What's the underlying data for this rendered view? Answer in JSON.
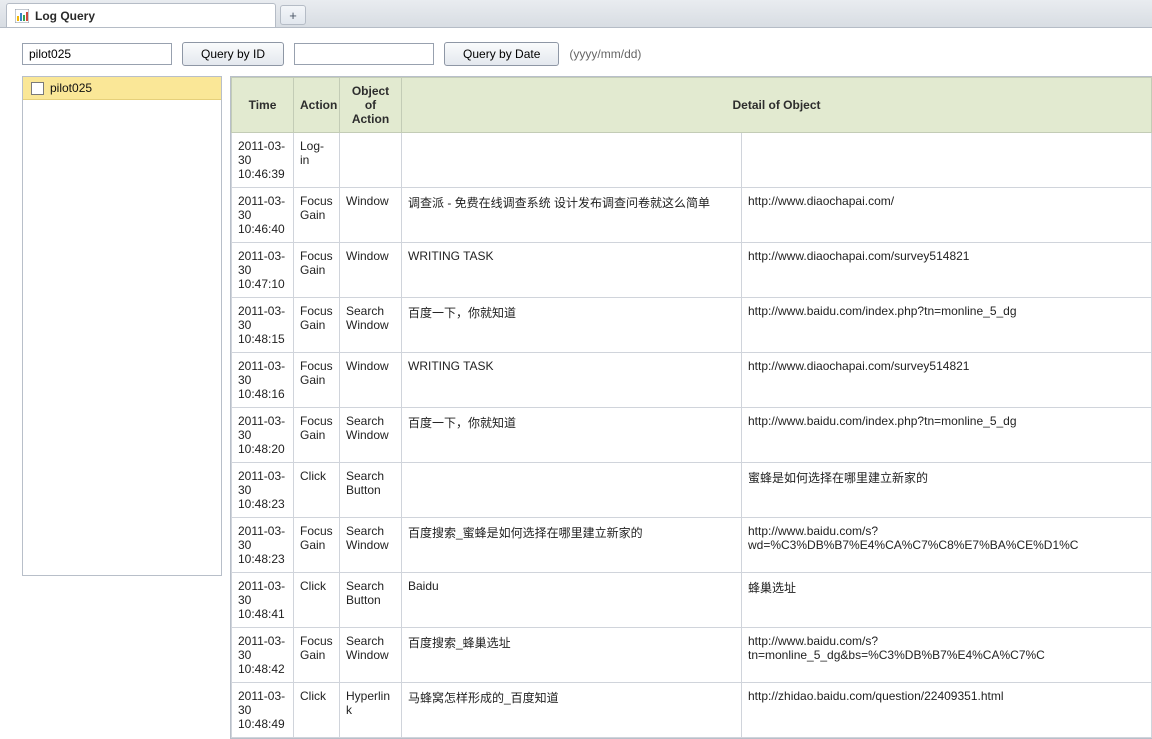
{
  "tab": {
    "title": "Log Query"
  },
  "query": {
    "id_value": "pilot025",
    "query_by_id_label": "Query by ID",
    "date_value": "",
    "query_by_date_label": "Query by Date",
    "date_hint": "(yyyy/mm/dd)"
  },
  "sidebar": {
    "items": [
      {
        "label": "pilot025"
      }
    ]
  },
  "table": {
    "columns": {
      "time": "Time",
      "action": "Action",
      "object_of_action": "Object of Action",
      "detail_of_object": "Detail of Object"
    },
    "rows": [
      {
        "time": "2011-03-30 10:46:39",
        "action": "Log-in",
        "object": "",
        "detail": "",
        "extra": "",
        "extra_link": false
      },
      {
        "time": "2011-03-30 10:46:40",
        "action": "Focus Gain",
        "object": "Window",
        "detail": "调查派 - 免费在线调查系统 设计发布调查问卷就这么简单",
        "extra": "http://www.diaochapai.com/",
        "extra_link": true
      },
      {
        "time": "2011-03-30 10:47:10",
        "action": "Focus Gain",
        "object": "Window",
        "detail": "WRITING TASK",
        "extra": "http://www.diaochapai.com/survey514821",
        "extra_link": true
      },
      {
        "time": "2011-03-30 10:48:15",
        "action": "Focus Gain",
        "object": "Search Window",
        "detail": "百度一下，你就知道",
        "extra": "http://www.baidu.com/index.php?tn=monline_5_dg",
        "extra_link": true
      },
      {
        "time": "2011-03-30 10:48:16",
        "action": "Focus Gain",
        "object": "Window",
        "detail": "WRITING TASK",
        "extra": "http://www.diaochapai.com/survey514821",
        "extra_link": true
      },
      {
        "time": "2011-03-30 10:48:20",
        "action": "Focus Gain",
        "object": "Search Window",
        "detail": "百度一下，你就知道",
        "extra": "http://www.baidu.com/index.php?tn=monline_5_dg",
        "extra_link": true
      },
      {
        "time": "2011-03-30 10:48:23",
        "action": "Click",
        "object": "Search Button",
        "detail": "",
        "extra": "蜜蜂是如何选择在哪里建立新家的",
        "extra_link": false
      },
      {
        "time": "2011-03-30 10:48:23",
        "action": "Focus Gain",
        "object": "Search Window",
        "detail": "百度搜索_蜜蜂是如何选择在哪里建立新家的",
        "extra": "http://www.baidu.com/s?wd=%C3%DB%B7%E4%CA%C7%C8%E7%BA%CE%D1%C",
        "extra_link": true
      },
      {
        "time": "2011-03-30 10:48:41",
        "action": "Click",
        "object": "Search Button",
        "detail": "Baidu",
        "extra": "蜂巢选址",
        "extra_link": false
      },
      {
        "time": "2011-03-30 10:48:42",
        "action": "Focus Gain",
        "object": "Search Window",
        "detail": "百度搜索_蜂巢选址",
        "extra": "http://www.baidu.com/s?tn=monline_5_dg&bs=%C3%DB%B7%E4%CA%C7%C",
        "extra_link": true
      },
      {
        "time": "2011-03-30 10:48:49",
        "action": "Click",
        "object": "Hyperlink",
        "detail": "马蜂窝怎样形成的_百度知道",
        "extra": "http://zhidao.baidu.com/question/22409351.html",
        "extra_link": true
      }
    ]
  }
}
